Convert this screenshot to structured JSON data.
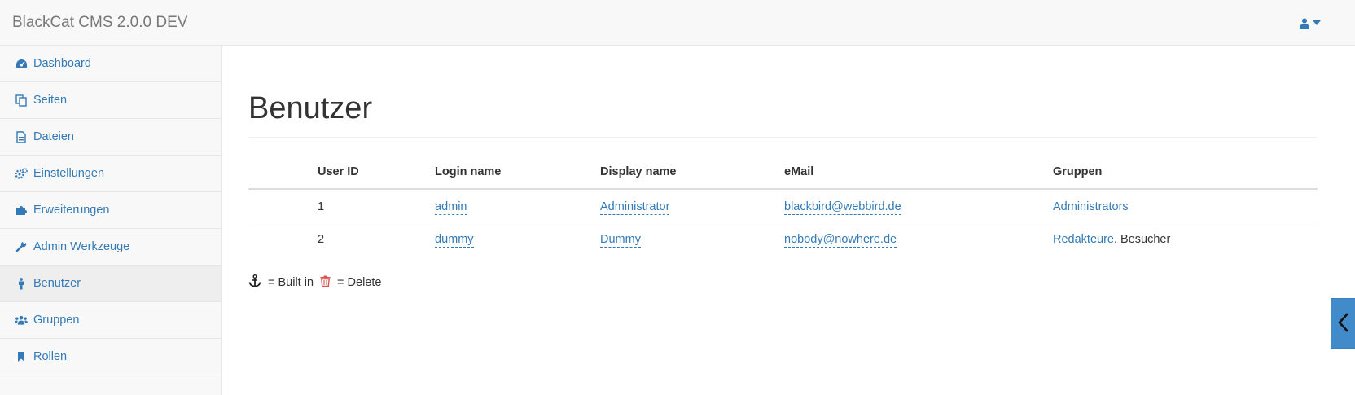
{
  "app": {
    "title": "BlackCat CMS 2.0.0 DEV"
  },
  "header": {
    "user_icon": "user-icon",
    "caret_icon": "caret-down-icon"
  },
  "sidebar": {
    "items": [
      {
        "label": "Dashboard",
        "icon": "dashboard-icon"
      },
      {
        "label": "Seiten",
        "icon": "copy-icon"
      },
      {
        "label": "Dateien",
        "icon": "file-icon"
      },
      {
        "label": "Einstellungen",
        "icon": "cogs-icon"
      },
      {
        "label": "Erweiterungen",
        "icon": "puzzle-icon"
      },
      {
        "label": "Admin Werkzeuge",
        "icon": "wrench-icon"
      },
      {
        "label": "Benutzer",
        "icon": "male-icon",
        "active": true
      },
      {
        "label": "Gruppen",
        "icon": "users-icon"
      },
      {
        "label": "Rollen",
        "icon": "bookmark-icon"
      }
    ]
  },
  "main": {
    "title": "Benutzer",
    "table": {
      "columns": [
        "User ID",
        "Login name",
        "Display name",
        "eMail",
        "Gruppen"
      ],
      "rows": [
        {
          "id": "1",
          "login": "admin",
          "display": "Administrator",
          "email": "blackbird@webbird.de",
          "groups": [
            "Administrators"
          ],
          "groups_plain": ""
        },
        {
          "id": "2",
          "login": "dummy",
          "display": "Dummy",
          "email": "nobody@nowhere.de",
          "groups": [
            "Redakteure"
          ],
          "groups_plain": ", Besucher"
        }
      ]
    },
    "legend": {
      "builtin": "= Built in",
      "delete": "= Delete",
      "builtin_icon": "anchor-icon",
      "delete_icon": "trash-icon"
    }
  },
  "side_tab": {
    "icon": "chevron-left-icon"
  },
  "colors": {
    "link": "#337ab7",
    "delete": "#d9534f",
    "tab": "#428bca"
  }
}
